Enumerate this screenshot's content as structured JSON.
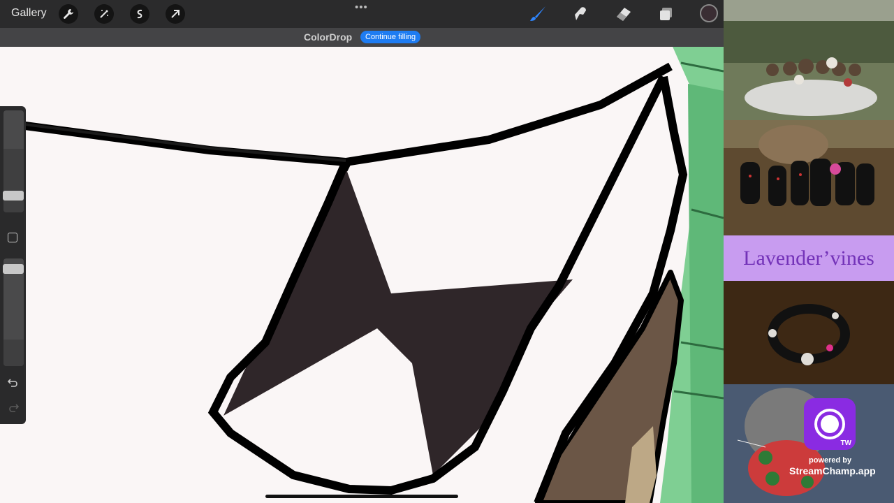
{
  "toolbar": {
    "gallery_label": "Gallery",
    "tools": [
      "wrench-icon",
      "magic-wand-icon",
      "selection-icon",
      "transform-arrow-icon"
    ],
    "more_glyph": "•••",
    "right_tools": [
      "brush-icon",
      "smudge-icon",
      "eraser-icon",
      "layers-icon"
    ],
    "active_tool": "brush-icon",
    "accent_color": "#2f86ff",
    "current_color": "#3a2d33"
  },
  "colordrop": {
    "title": "ColorDrop",
    "continue_label": "Continue filling"
  },
  "sidebar": {
    "brush_size_level": 0.62,
    "opacity_level": 0.25
  },
  "stream_overlay": {
    "brand_text": "Lavender’vines",
    "brand_bg": "#c89cf0",
    "brand_text_color": "#7332b8",
    "badge_label": "TW",
    "powered_by": "powered by",
    "service": "StreamChamp.app"
  }
}
